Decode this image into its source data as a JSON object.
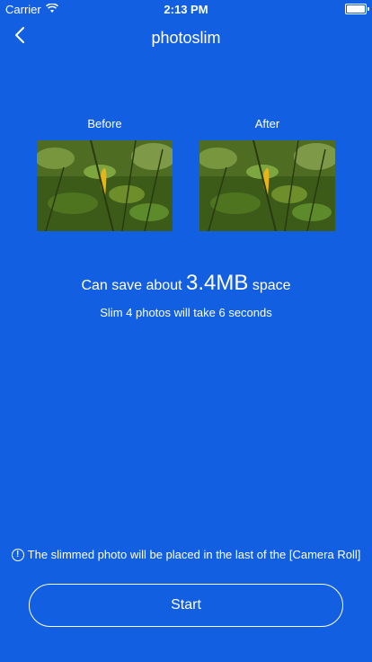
{
  "status_bar": {
    "carrier": "Carrier",
    "time": "2:13 PM",
    "icons": [
      "wifi-icon",
      "battery-icon"
    ]
  },
  "nav": {
    "title": "photoslim",
    "back_icon": "chevron-left-icon"
  },
  "compare": {
    "before_label": "Before",
    "after_label": "After"
  },
  "savings": {
    "prefix": "Can save about",
    "amount": "3.4MB",
    "suffix": "space"
  },
  "duration_text": "Slim 4 photos will take 6 seconds",
  "notice": {
    "icon": "exclamation-circle-icon",
    "text": "The slimmed photo will be placed in the last of the [Camera Roll]"
  },
  "start_button_label": "Start",
  "colors": {
    "background": "#135fe2",
    "text": "#ffffff"
  }
}
